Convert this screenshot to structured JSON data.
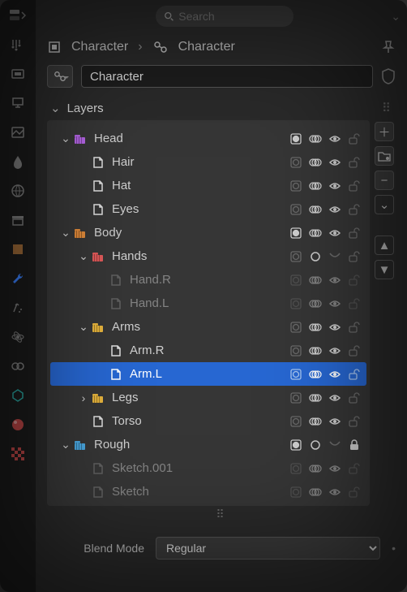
{
  "search": {
    "placeholder": "Search"
  },
  "breadcrumb": {
    "a": "Character",
    "b": "Character"
  },
  "name_field": "Character",
  "panel": {
    "title": "Layers"
  },
  "colors": {
    "purple": "#b566e6",
    "orange": "#e08a3a",
    "red": "#e05a5a",
    "yellow": "#e6b43d",
    "blue": "#4aa7e0",
    "grey": "#9a9a9a"
  },
  "nodes": [
    {
      "id": "head",
      "kind": "group",
      "label": "Head",
      "indent": 0,
      "open": true,
      "color": "purple",
      "t1": "on",
      "t2": "on",
      "t3": "on",
      "t4": "unlock"
    },
    {
      "id": "hair",
      "kind": "layer",
      "label": "Hair",
      "indent": 1,
      "t1": "off",
      "t2": "on",
      "t3": "on",
      "t4": "unlock"
    },
    {
      "id": "hat",
      "kind": "layer",
      "label": "Hat",
      "indent": 1,
      "t1": "off",
      "t2": "on",
      "t3": "on",
      "t4": "unlock"
    },
    {
      "id": "eyes",
      "kind": "layer",
      "label": "Eyes",
      "indent": 1,
      "t1": "off",
      "t2": "on",
      "t3": "on",
      "t4": "unlock"
    },
    {
      "id": "body",
      "kind": "group",
      "label": "Body",
      "indent": 0,
      "open": true,
      "color": "orange",
      "t1": "on",
      "t2": "on",
      "t3": "on",
      "t4": "unlock"
    },
    {
      "id": "hands",
      "kind": "group",
      "label": "Hands",
      "indent": 1,
      "open": true,
      "color": "red",
      "t1": "off",
      "t2": "ring",
      "t3": "off",
      "t4": "unlock"
    },
    {
      "id": "handr",
      "kind": "layer",
      "label": "Hand.R",
      "indent": 2,
      "dim": true,
      "t1": "off",
      "t2": "on",
      "t3": "on",
      "t4": "unlock"
    },
    {
      "id": "handl",
      "kind": "layer",
      "label": "Hand.L",
      "indent": 2,
      "dim": true,
      "t1": "off",
      "t2": "on",
      "t3": "on",
      "t4": "unlock"
    },
    {
      "id": "arms",
      "kind": "group",
      "label": "Arms",
      "indent": 1,
      "open": true,
      "color": "yellow",
      "t1": "off",
      "t2": "on",
      "t3": "on",
      "t4": "unlock"
    },
    {
      "id": "armr",
      "kind": "layer",
      "label": "Arm.R",
      "indent": 2,
      "t1": "off",
      "t2": "on",
      "t3": "on",
      "t4": "unlock"
    },
    {
      "id": "arml",
      "kind": "layer",
      "label": "Arm.L",
      "indent": 2,
      "selected": true,
      "t1": "off",
      "t2": "on",
      "t3": "on",
      "t4": "unlock"
    },
    {
      "id": "legs",
      "kind": "group",
      "label": "Legs",
      "indent": 1,
      "open": false,
      "color": "yellow",
      "t1": "off",
      "t2": "on",
      "t3": "on",
      "t4": "unlock"
    },
    {
      "id": "torso",
      "kind": "layer",
      "label": "Torso",
      "indent": 1,
      "t1": "off",
      "t2": "on",
      "t3": "on",
      "t4": "unlock"
    },
    {
      "id": "rough",
      "kind": "group",
      "label": "Rough",
      "indent": 0,
      "open": true,
      "color": "blue",
      "t1": "on",
      "t2": "ring",
      "t3": "off",
      "t4": "lock"
    },
    {
      "id": "sk001",
      "kind": "layer",
      "label": "Sketch.001",
      "indent": 1,
      "dim": true,
      "t1": "off",
      "t2": "on",
      "t3": "on",
      "t4": "unlock"
    },
    {
      "id": "sketch",
      "kind": "layer",
      "label": "Sketch",
      "indent": 1,
      "dim": true,
      "t1": "off",
      "t2": "on",
      "t3": "on",
      "t4": "unlock"
    }
  ],
  "blend": {
    "label": "Blend Mode",
    "value": "Regular"
  }
}
